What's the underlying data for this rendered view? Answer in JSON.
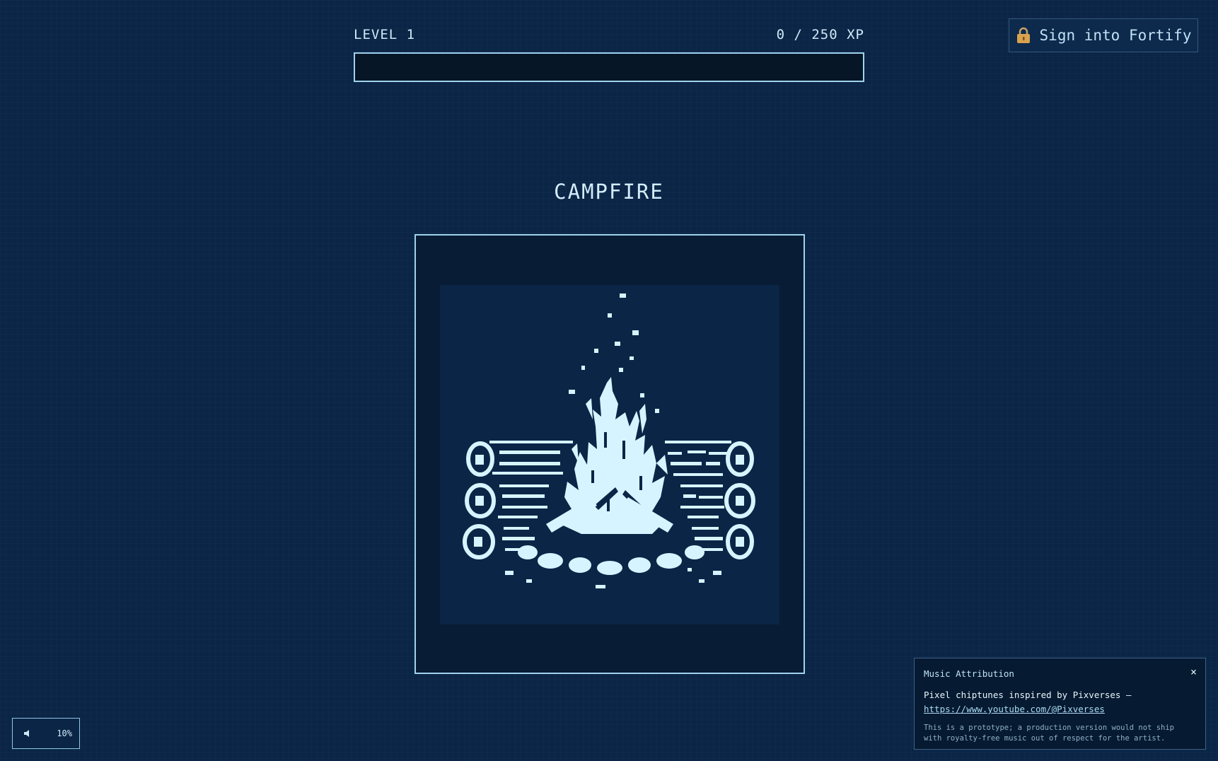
{
  "header": {
    "level_label": "LEVEL 1",
    "xp_text": "0 / 250 XP",
    "xp_progress": 0
  },
  "signin": {
    "label": "Sign into Fortify",
    "icon": "lock-icon"
  },
  "activity": {
    "title": "CAMPFIRE"
  },
  "volume": {
    "icon": "speaker-icon",
    "value": "10%"
  },
  "attribution": {
    "heading": "Music Attribution",
    "close": "×",
    "credit": "Pixel chiptunes inspired by Pixverses —",
    "link": "https://www.youtube.com/@Pixverses",
    "note": "This is a prototype; a production version would not ship with royalty-free music out of respect for the artist."
  },
  "colors": {
    "background": "#0b2547",
    "accent": "#9fd3ee",
    "art": "#d6f4ff"
  }
}
